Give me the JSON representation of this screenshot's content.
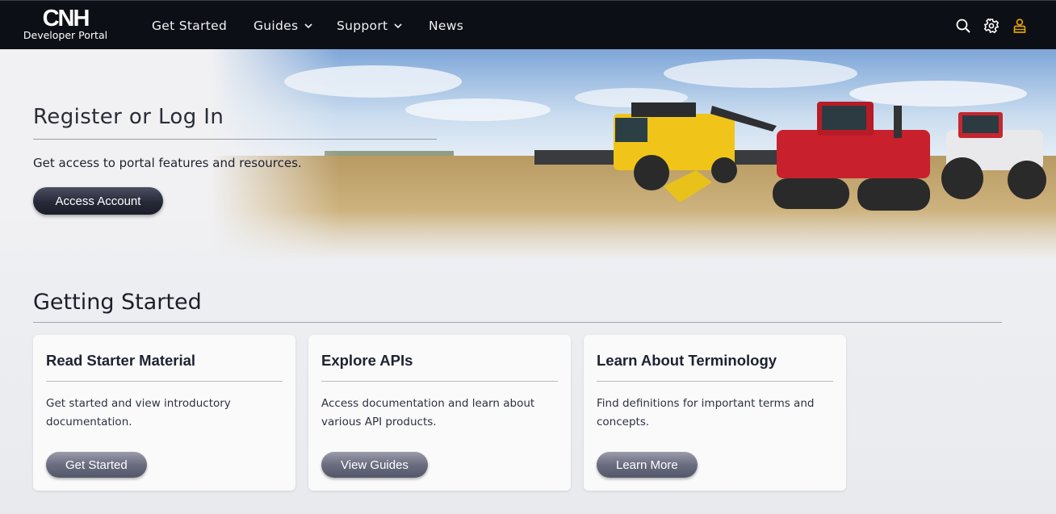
{
  "header": {
    "logo_mark": "CNH",
    "logo_subtitle": "Developer Portal",
    "nav": [
      {
        "label": "Get Started"
      },
      {
        "label": "Guides"
      },
      {
        "label": "Support"
      },
      {
        "label": "News"
      }
    ],
    "icons": [
      "search-icon",
      "gear-icon",
      "user-icon"
    ],
    "colors": {
      "background": "#0d0f16",
      "user_icon": "#e0a100"
    }
  },
  "hero": {
    "title": "Register or Log In",
    "text": "Get access to portal features and resources.",
    "button_label": "Access Account"
  },
  "getting_started": {
    "title": "Getting Started",
    "cards": [
      {
        "title": "Read Starter Material",
        "text": "Get started and view introductory documentation.",
        "button_label": "Get Started"
      },
      {
        "title": "Explore APIs",
        "text": "Access documentation and learn about various API products.",
        "button_label": "View Guides"
      },
      {
        "title": "Learn About Terminology",
        "text": "Find definitions for important terms and concepts.",
        "button_label": "Learn More"
      }
    ]
  }
}
